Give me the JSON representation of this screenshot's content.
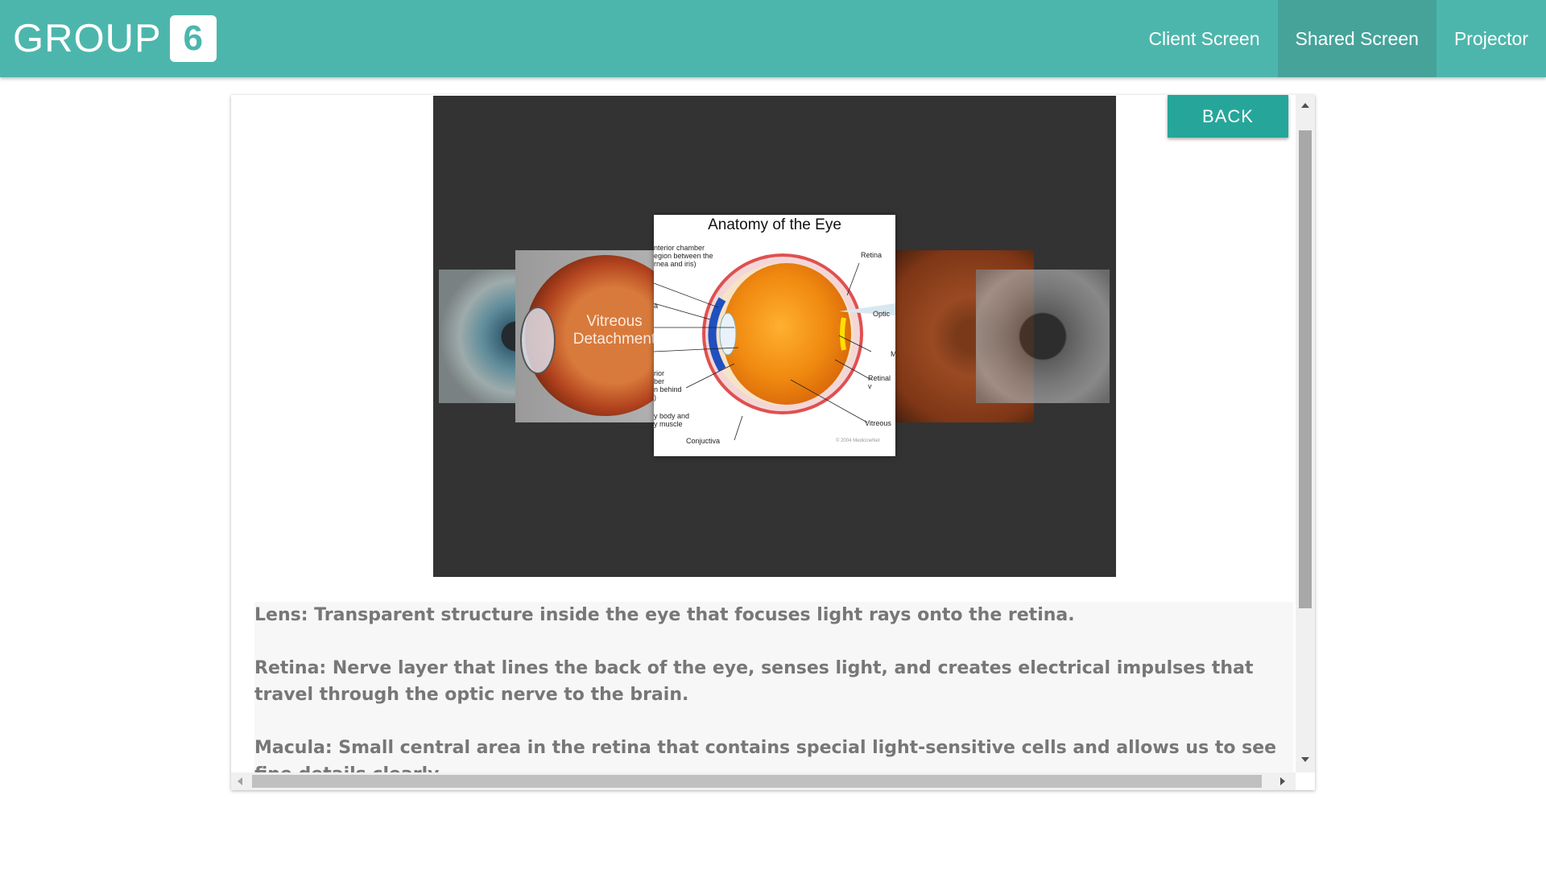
{
  "navbar": {
    "brand_text": "GROUP",
    "brand_badge": "6",
    "links": [
      {
        "label": "Client Screen",
        "active": false
      },
      {
        "label": "Shared Screen",
        "active": true
      },
      {
        "label": "Projector",
        "active": false
      }
    ],
    "color": "#4db6ac"
  },
  "viewer": {
    "main_image": {
      "title": "Anatomy of the Eye",
      "labels": {
        "anterior": "nterior chamber\negion between the\nrnea and iris)",
        "retina": "Retina",
        "optic": "Optic",
        "m": "M",
        "retinal": "Retinal\nv",
        "vitreous": "Vitreous",
        "iris_a": "a",
        "posterior": "rior\nber\nn behind\n)",
        "ciliary": "y body and\ny muscle",
        "conjunctiva": "Conjuctiva",
        "copyright": "© 2004 MedicineNet"
      }
    },
    "side_caption": "Vitreous\nDetachment"
  },
  "back_button": {
    "label": "BACK",
    "color": "#26a69a"
  },
  "description": {
    "paragraphs": [
      "Lens: Transparent structure inside the eye that focuses light rays onto the retina.",
      "Retina: Nerve layer that lines the back of the eye, senses light, and creates electrical impulses that travel through the optic nerve to the brain.",
      "Macula: Small central area in the retina that contains special light-sensitive cells and allows us to see fine details clearly."
    ]
  }
}
